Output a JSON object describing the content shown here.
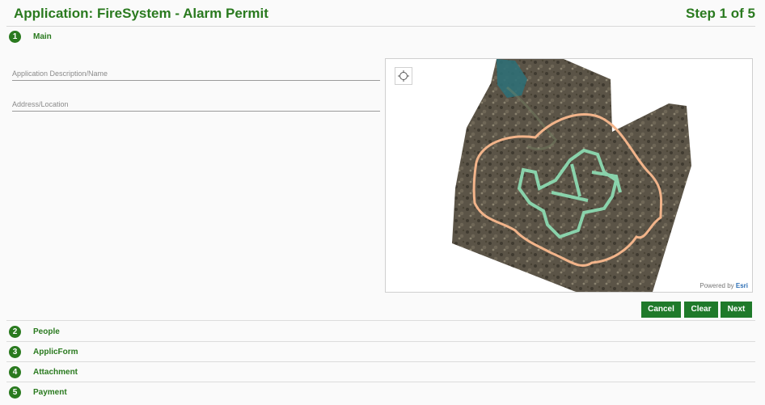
{
  "header": {
    "title": "Application: FireSystem - Alarm Permit",
    "step": "Step 1 of 5"
  },
  "sections": [
    {
      "number": "1",
      "label": "Main"
    },
    {
      "number": "2",
      "label": "People"
    },
    {
      "number": "3",
      "label": "ApplicForm"
    },
    {
      "number": "4",
      "label": "Attachment"
    },
    {
      "number": "5",
      "label": "Payment"
    }
  ],
  "form": {
    "description_placeholder": "Application Description/Name",
    "description_value": "",
    "address_placeholder": "Address/Location",
    "address_value": ""
  },
  "map": {
    "powered_by": "Powered by",
    "provider": "Esri",
    "locate_icon": "crosshair-icon"
  },
  "buttons": {
    "cancel": "Cancel",
    "clear": "Clear",
    "next": "Next"
  },
  "colors": {
    "accent_green": "#2a7a1f",
    "button_green": "#1f7a2a",
    "boundary_orange": "#f2b48a",
    "route_mint": "#8ee0b6"
  }
}
